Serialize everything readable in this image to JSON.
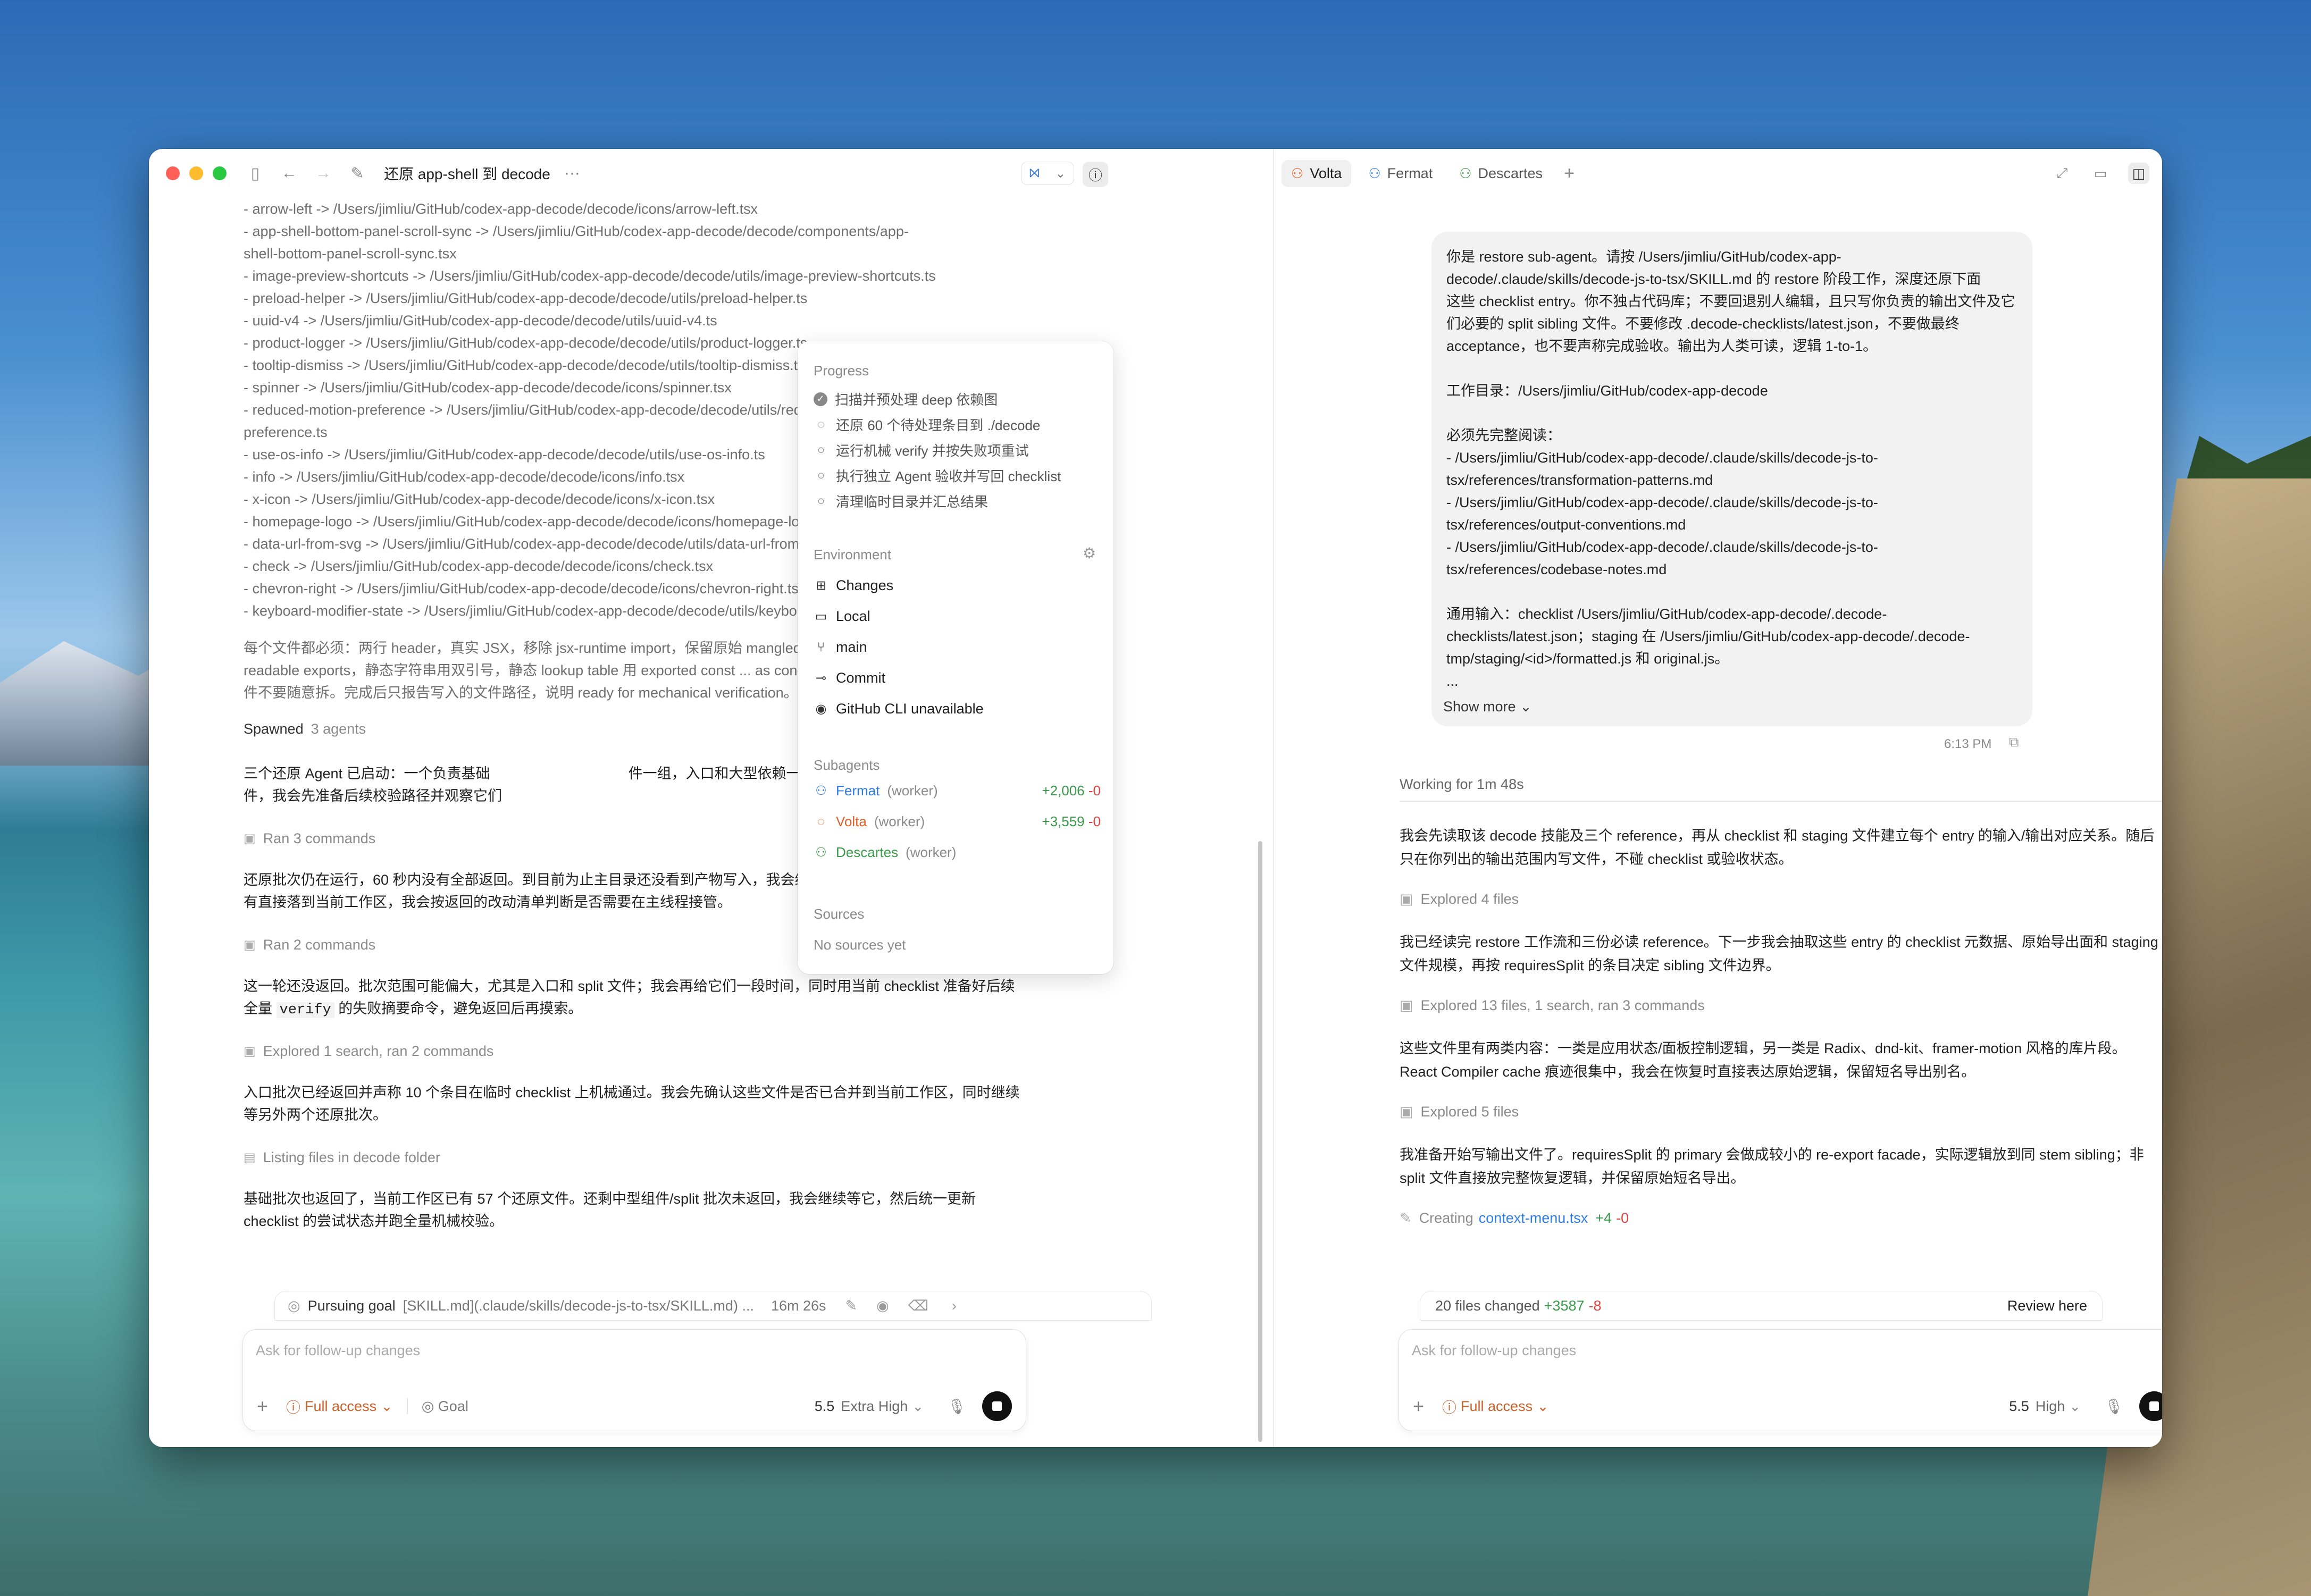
{
  "window": {
    "title": "还原 app-shell 到 decode",
    "more": "···"
  },
  "left_log": [
    "- arrow-left -> /Users/jimliu/GitHub/codex-app-decode/decode/icons/arrow-left.tsx",
    "- app-shell-bottom-panel-scroll-sync -> /Users/jimliu/GitHub/codex-app-decode/decode/components/app-",
    "shell-bottom-panel-scroll-sync.tsx",
    "- image-preview-shortcuts -> /Users/jimliu/GitHub/codex-app-decode/decode/utils/image-preview-shortcuts.ts",
    "- preload-helper -> /Users/jimliu/GitHub/codex-app-decode/decode/utils/preload-helper.ts",
    "- uuid-v4 -> /Users/jimliu/GitHub/codex-app-decode/decode/utils/uuid-v4.ts",
    "- product-logger -> /Users/jimliu/GitHub/codex-app-decode/decode/utils/product-logger.ts",
    "- tooltip-dismiss -> /Users/jimliu/GitHub/codex-app-decode/decode/utils/tooltip-dismiss.ts",
    "- spinner -> /Users/jimliu/GitHub/codex-app-decode/decode/icons/spinner.tsx",
    "- reduced-motion-preference -> /Users/jimliu/GitHub/codex-app-decode/decode/utils/reduced-motion-",
    "preference.ts",
    "- use-os-info -> /Users/jimliu/GitHub/codex-app-decode/decode/utils/use-os-info.ts",
    "- info -> /Users/jimliu/GitHub/codex-app-decode/decode/icons/info.tsx",
    "- x-icon -> /Users/jimliu/GitHub/codex-app-decode/decode/icons/x-icon.tsx",
    "- homepage-logo -> /Users/jimliu/GitHub/codex-app-decode/decode/icons/homepage-logo.tsx",
    "- data-url-from-svg -> /Users/jimliu/GitHub/codex-app-decode/decode/utils/data-url-from-svg.ts",
    "- check -> /Users/jimliu/GitHub/codex-app-decode/decode/icons/check.tsx",
    "- chevron-right -> /Users/jimliu/GitHub/codex-app-decode/decode/icons/chevron-right.tsx",
    "- keyboard-modifier-state -> /Users/jimliu/GitHub/codex-app-decode/decode/utils/keyboard-modifier-state.ts"
  ],
  "left_req": [
    "每个文件都必须：两行 header，真实 JSX，移除 jsx-runtime import，保留原始 mangled",
    "readable exports，静态字符串用双引号，静态 lookup table 用 exported const ... as const",
    "件不要随意拆。完成后只报告写入的文件路径，说明 ready for mechanical verification。"
  ],
  "spawned": {
    "label": "Spawned",
    "count": "3 agents"
  },
  "left_msgs": {
    "m1": [
      "三个还原 Agent 已启动：一个负责基础",
      "件一组，入口和大型依赖一组",
      "件，我会先准备后续校验路径并观察它们"
    ],
    "meta1": "Ran 3 commands",
    "m2": [
      "还原批次仍在运行，60 秒内没有全部返回。到目前为止主目录还没看到产物写入，我会继续等待一轮；如果 Agent 产物没",
      "有直接落到当前工作区，我会按返回的改动清单判断是否需要在主线程接管。"
    ],
    "meta2": "Ran 2 commands",
    "m3a": "这一轮还没返回。批次范围可能偏大，尤其是入口和 split 文件；我会再给它们一段时间，同时用当前 checklist 准备好后续",
    "m3b_pre": "全量 ",
    "m3b_code": "verify",
    "m3b_post": " 的失败摘要命令，避免返回后再摸索。",
    "meta3": "Explored 1 search, ran 2 commands",
    "m4": [
      "入口批次已经返回并声称 10 个条目在临时 checklist 上机械通过。我会先确认这些文件是否已合并到当前工作区，同时继续",
      "等另外两个还原批次。"
    ],
    "meta4": "Listing files in decode folder",
    "m5": [
      "基础批次也返回了，当前工作区已有 57 个还原文件。还剩中型组件/split 批次未返回，我会继续等它，然后统一更新",
      "checklist 的尝试状态并跑全量机械校验。"
    ]
  },
  "popover": {
    "progress_title": "Progress",
    "progress": [
      "扫描并预处理 deep 依赖图",
      "还原 60 个待处理条目到 ./decode",
      "运行机械 verify 并按失败项重试",
      "执行独立 Agent 验收并写回 checklist",
      "清理临时目录并汇总结果"
    ],
    "env_title": "Environment",
    "env": [
      "Changes",
      "Local",
      "main",
      "Commit",
      "GitHub CLI unavailable"
    ],
    "subagents_title": "Subagents",
    "subagents": [
      {
        "name": "Fermat",
        "role": "(worker)",
        "plus": "+2,006",
        "minus": "-0",
        "color": "#2f7de1"
      },
      {
        "name": "Volta",
        "role": "(worker)",
        "plus": "+3,559",
        "minus": "-0",
        "color": "#e0622a"
      },
      {
        "name": "Descartes",
        "role": "(worker)",
        "plus": "",
        "minus": "",
        "color": "#3a9a4a"
      }
    ],
    "sources_title": "Sources",
    "sources_empty": "No sources yet"
  },
  "left_goal": {
    "label": "Pursuing goal",
    "path": "[SKILL.md](.claude/skills/decode-js-to-tsx/SKILL.md) ...",
    "time": "16m 26s"
  },
  "left_composer": {
    "placeholder": "Ask for follow-up changes",
    "access": "Full access",
    "goal": "Goal",
    "model": "5.5",
    "effort": "Extra High"
  },
  "tabs": [
    "Volta",
    "Fermat",
    "Descartes"
  ],
  "bubble": [
    "你是 restore sub-agent。请按 /Users/jimliu/GitHub/codex-app-",
    "decode/.claude/skills/decode-js-to-tsx/SKILL.md 的 restore 阶段工作，深度还原下面",
    "这些 checklist entry。你不独占代码库；不要回退别人编辑，且只写你负责的输出文件及它",
    "们必要的 split sibling 文件。不要修改 .decode-checklists/latest.json，不要做最终",
    "acceptance，也不要声称完成验收。输出为人类可读，逻辑 1-to-1。",
    "",
    "工作目录：/Users/jimliu/GitHub/codex-app-decode",
    "",
    "必须先完整阅读：",
    "- /Users/jimliu/GitHub/codex-app-decode/.claude/skills/decode-js-to-",
    "tsx/references/transformation-patterns.md",
    "- /Users/jimliu/GitHub/codex-app-decode/.claude/skills/decode-js-to-",
    "tsx/references/output-conventions.md",
    "- /Users/jimliu/GitHub/codex-app-decode/.claude/skills/decode-js-to-",
    "tsx/references/codebase-notes.md",
    "",
    "通用输入：checklist /Users/jimliu/GitHub/codex-app-decode/.decode-",
    "checklists/latest.json；staging 在 /Users/jimliu/GitHub/codex-app-decode/.decode-",
    "tmp/staging/<id>/formatted.js 和 original.js。",
    "..."
  ],
  "show_more": "Show more",
  "time": "6:13 PM",
  "working": "Working for 1m 48s",
  "right_msgs": {
    "r1": [
      "我会先读取该 decode 技能及三个 reference，再从 checklist 和 staging 文件建立每个 entry 的输入/输出对应关系。随后",
      "只在你列出的输出范围内写文件，不碰 checklist 或验收状态。"
    ],
    "meta1": "Explored 4 files",
    "r2": [
      "我已经读完 restore 工作流和三份必读 reference。下一步我会抽取这些 entry 的 checklist 元数据、原始导出面和 staging",
      "文件规模，再按 requiresSplit 的条目决定 sibling 文件边界。"
    ],
    "meta2": "Explored 13 files, 1 search, ran 3 commands",
    "r3": [
      "这些文件里有两类内容：一类是应用状态/面板控制逻辑，另一类是 Radix、dnd-kit、framer-motion 风格的库片段。",
      "React Compiler cache 痕迹很集中，我会在恢复时直接表达原始逻辑，保留短名导出别名。"
    ],
    "meta3": "Explored 5 files",
    "r4": [
      "我准备开始写输出文件了。requiresSplit 的 primary 会做成较小的 re-export facade，实际逻辑放到同 stem sibling；非",
      "split 文件直接放完整恢复逻辑，并保留原始短名导出。"
    ],
    "creating": "Creating",
    "creating_file": "context-menu.tsx",
    "creating_plus": "+4",
    "creating_minus": "-0"
  },
  "right_files": {
    "label": "20 files changed",
    "plus": "+3587",
    "minus": "-8",
    "review": "Review here"
  },
  "right_composer": {
    "placeholder": "Ask for follow-up changes",
    "access": "Full access",
    "model": "5.5",
    "effort": "High"
  },
  "colors": {
    "accent_blue": "#2f7de1",
    "access_orange": "#c7622a",
    "plus_green": "#3a9a4a",
    "minus_red": "#d44444"
  }
}
